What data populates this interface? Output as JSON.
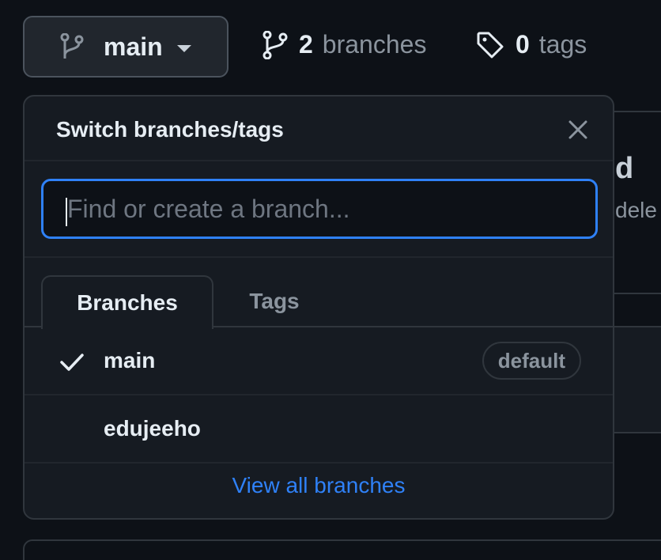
{
  "header": {
    "branch_button_label": "main",
    "branches_count": "2",
    "branches_word": "branches",
    "tags_count": "0",
    "tags_word": "tags"
  },
  "background": {
    "fragment_letter": "d",
    "fragment_text": "dele"
  },
  "dropdown": {
    "title": "Switch branches/tags",
    "search_placeholder": "Find or create a branch...",
    "tabs": [
      {
        "label": "Branches",
        "active": true
      },
      {
        "label": "Tags",
        "active": false
      }
    ],
    "branches": [
      {
        "name": "main",
        "selected": true,
        "badge": "default"
      },
      {
        "name": "edujeeho",
        "selected": false,
        "badge": ""
      }
    ],
    "view_all_label": "View all branches"
  },
  "colors": {
    "accent": "#2f81f7",
    "background": "#0d1117",
    "panel": "#161b22",
    "border": "#30363d",
    "muted_text": "#8b949e"
  }
}
